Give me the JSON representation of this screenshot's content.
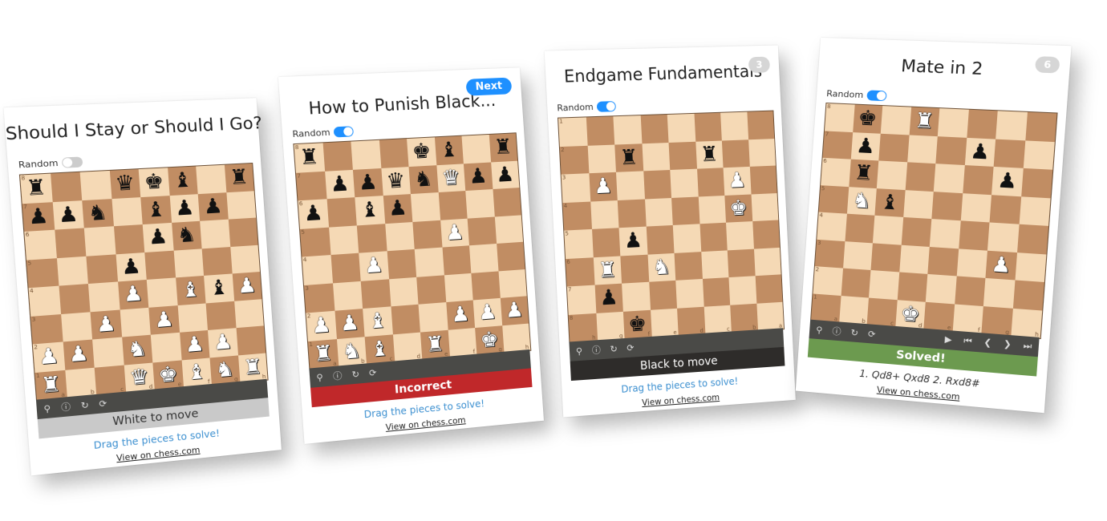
{
  "cards": [
    {
      "title": "Should I Stay or Should I Go?",
      "random_label": "Random",
      "random_on": false,
      "status": "White to move",
      "hint": "Drag the pieces to solve!",
      "link": "View on chess.com",
      "files": [
        "a",
        "b",
        "c",
        "d",
        "e",
        "f",
        "g",
        "h"
      ],
      "ranks": [
        "8",
        "7",
        "6",
        "5",
        "4",
        "3",
        "2",
        "1"
      ],
      "board": [
        "r..qkb.r",
        "ppn.bpp.",
        "....pn..",
        "...p....",
        "...P.BbP",
        "..P.P...",
        "PP.N.PP.",
        "R..QKBNR"
      ]
    },
    {
      "title": "How to Punish Black...",
      "next_label": "Next",
      "random_label": "Random",
      "random_on": true,
      "status": "Incorrect",
      "hint": "Drag the pieces to solve!",
      "link": "View on chess.com",
      "files": [
        "a",
        "b",
        "c",
        "d",
        "e",
        "f",
        "g",
        "h"
      ],
      "ranks": [
        "8",
        "7",
        "6",
        "5",
        "4",
        "3",
        "2",
        "1"
      ],
      "board": [
        "r...kb.r",
        ".ppqnQpp",
        "p.bp....",
        ".....P..",
        "..P.....",
        "........",
        "PPB..PPP",
        "RNB.R.K."
      ]
    },
    {
      "title": "Endgame Fundamentals",
      "badge": "3",
      "random_label": "Random",
      "random_on": true,
      "status": "Black to move",
      "hint": "Drag the pieces to solve!",
      "link": "View on chess.com",
      "files": [
        "h",
        "g",
        "f",
        "e",
        "d",
        "c",
        "b",
        "a"
      ],
      "ranks": [
        "1",
        "2",
        "3",
        "4",
        "5",
        "6",
        "7",
        "8"
      ],
      "board": [
        "........",
        "..r..r..",
        ".P....P.",
        "......K.",
        "..p.....",
        ".R.N....",
        ".p......",
        "..k....."
      ]
    },
    {
      "title": "Mate in 2",
      "badge": "6",
      "random_label": "Random",
      "random_on": true,
      "status": "Solved!",
      "moves": "1. Qd8+ Qxd8 2. Rxd8#",
      "link": "View on chess.com",
      "files": [
        "a",
        "b",
        "c",
        "d",
        "e",
        "f",
        "g",
        "h"
      ],
      "ranks": [
        "8",
        "7",
        "6",
        "5",
        "4",
        "3",
        "2",
        "1"
      ],
      "board": [
        ".k.R....",
        ".p...p..",
        ".r....p.",
        ".Nb.....",
        "........",
        "......P.",
        "........",
        "...K...."
      ]
    }
  ],
  "icons": {
    "hint": "lightbulb-icon",
    "help": "question-icon",
    "retry": "retry-icon",
    "flip": "flip-icon",
    "play": "play-icon",
    "first": "first-icon",
    "prev": "prev-icon",
    "next": "next-icon",
    "last": "last-icon"
  },
  "colors": {
    "light_square": "#f5d9b5",
    "dark_square": "#c18d63",
    "incorrect": "#c0282a",
    "solved": "#6c9a4f",
    "accent": "#1e90ff"
  }
}
